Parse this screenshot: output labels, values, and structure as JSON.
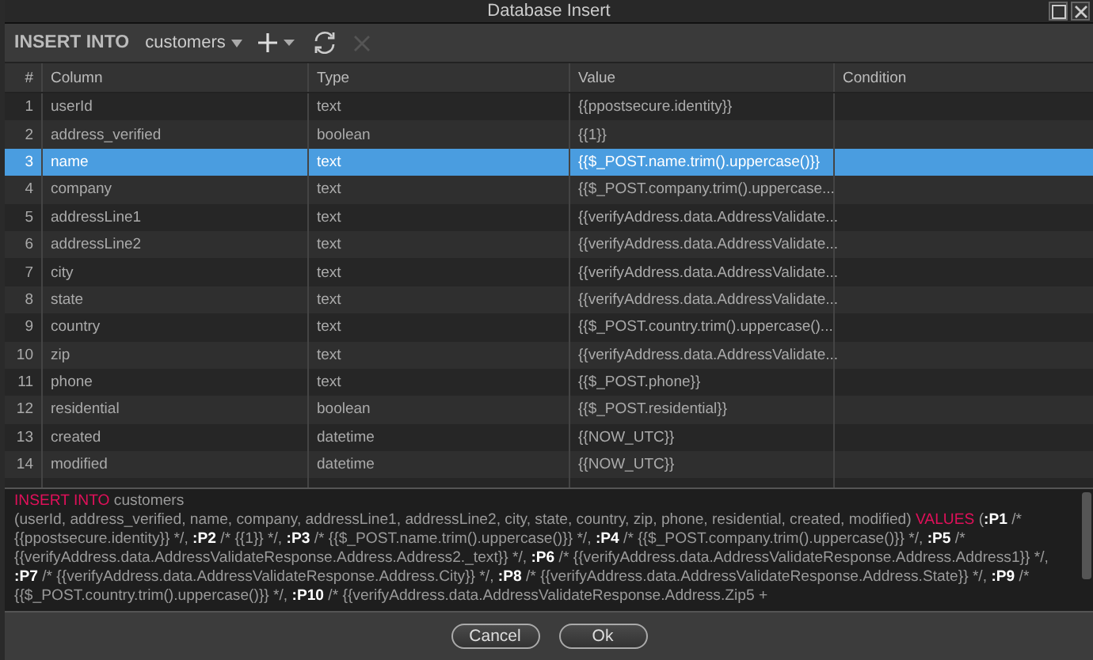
{
  "window": {
    "title": "Database Insert"
  },
  "toolbar": {
    "label": "INSERT INTO",
    "table": "customers",
    "delete_disabled": true
  },
  "table": {
    "columns": [
      "#",
      "Column",
      "Type",
      "Value",
      "Condition"
    ],
    "rows": [
      {
        "num": "1",
        "column": "userId",
        "type": "text",
        "value": "{{ppostsecure.identity}}",
        "selected": false
      },
      {
        "num": "2",
        "column": "address_verified",
        "type": "boolean",
        "value": "{{1}}",
        "selected": false
      },
      {
        "num": "3",
        "column": "name",
        "type": "text",
        "value": "{{$_POST.name.trim().uppercase()}}",
        "selected": true
      },
      {
        "num": "4",
        "column": "company",
        "type": "text",
        "value": "{{$_POST.company.trim().uppercase...",
        "selected": false
      },
      {
        "num": "5",
        "column": "addressLine1",
        "type": "text",
        "value": "{{verifyAddress.data.AddressValidate...",
        "selected": false
      },
      {
        "num": "6",
        "column": "addressLine2",
        "type": "text",
        "value": "{{verifyAddress.data.AddressValidate...",
        "selected": false
      },
      {
        "num": "7",
        "column": "city",
        "type": "text",
        "value": "{{verifyAddress.data.AddressValidate...",
        "selected": false
      },
      {
        "num": "8",
        "column": "state",
        "type": "text",
        "value": "{{verifyAddress.data.AddressValidate...",
        "selected": false
      },
      {
        "num": "9",
        "column": "country",
        "type": "text",
        "value": "{{$_POST.country.trim().uppercase()...",
        "selected": false
      },
      {
        "num": "10",
        "column": "zip",
        "type": "text",
        "value": "{{verifyAddress.data.AddressValidate...",
        "selected": false
      },
      {
        "num": "11",
        "column": "phone",
        "type": "text",
        "value": "{{$_POST.phone}}",
        "selected": false
      },
      {
        "num": "12",
        "column": "residential",
        "type": "boolean",
        "value": "{{$_POST.residential}}",
        "selected": false
      },
      {
        "num": "13",
        "column": "created",
        "type": "datetime",
        "value": "{{NOW_UTC}}",
        "selected": false
      },
      {
        "num": "14",
        "column": "modified",
        "type": "datetime",
        "value": "{{NOW_UTC}}",
        "selected": false
      }
    ]
  },
  "sql": [
    [
      {
        "kind": "keyword",
        "text": "INSERT INTO"
      },
      {
        "kind": "text",
        "text": " customers"
      }
    ],
    [
      {
        "kind": "text",
        "text": "(userId, address_verified, name, company, addressLine1, addressLine2, city, state, country, zip, phone, residential, created, modified) "
      },
      {
        "kind": "keyword",
        "text": "VALUES"
      },
      {
        "kind": "text",
        "text": " ("
      },
      {
        "kind": "param",
        "text": ":P1"
      },
      {
        "kind": "text",
        "text": " /* {{ppostsecure.identity}} */, "
      },
      {
        "kind": "param",
        "text": ":P2"
      },
      {
        "kind": "text",
        "text": " /* {{1}} */, "
      },
      {
        "kind": "param",
        "text": ":P3"
      },
      {
        "kind": "text",
        "text": " /* {{$_POST.name.trim().uppercase()}} */, "
      },
      {
        "kind": "param",
        "text": ":P4"
      },
      {
        "kind": "text",
        "text": " /* {{$_POST.company.trim().uppercase()}} */, "
      },
      {
        "kind": "param",
        "text": ":P5"
      },
      {
        "kind": "text",
        "text": " /* {{verifyAddress.data.AddressValidateResponse.Address.Address2._text}} */, "
      },
      {
        "kind": "param",
        "text": ":P6"
      },
      {
        "kind": "text",
        "text": " /* {{verifyAddress.data.AddressValidateResponse.Address.Address1}} */, "
      },
      {
        "kind": "param",
        "text": ":P7"
      },
      {
        "kind": "text",
        "text": " /* {{verifyAddress.data.AddressValidateResponse.Address.City}} */, "
      },
      {
        "kind": "param",
        "text": ":P8"
      },
      {
        "kind": "text",
        "text": " /* {{verifyAddress.data.AddressValidateResponse.Address.State}} */, "
      },
      {
        "kind": "param",
        "text": ":P9"
      },
      {
        "kind": "text",
        "text": " /* {{$_POST.country.trim().uppercase()}} */, "
      },
      {
        "kind": "param",
        "text": ":P10"
      },
      {
        "kind": "text",
        "text": " /* {{verifyAddress.data.AddressValidateResponse.Address.Zip5 +"
      }
    ]
  ],
  "buttons": [
    "Cancel",
    "Ok"
  ]
}
